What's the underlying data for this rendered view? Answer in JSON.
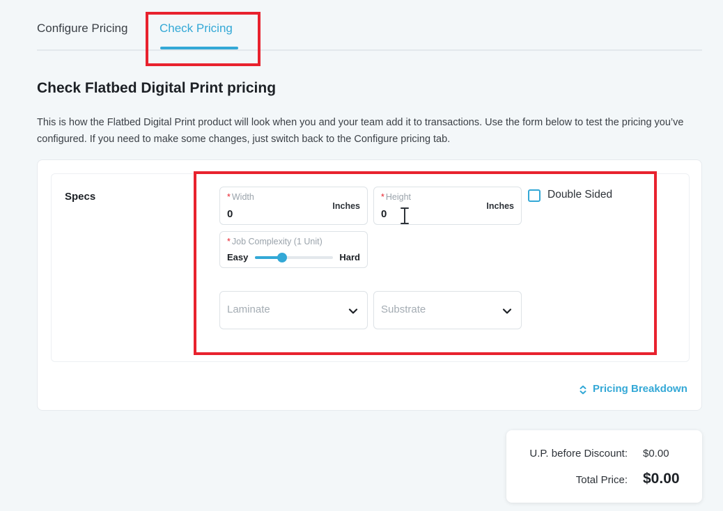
{
  "tabs": [
    {
      "label": "Configure Pricing",
      "active": false
    },
    {
      "label": "Check Pricing",
      "active": true
    }
  ],
  "heading": "Check Flatbed Digital Print pricing",
  "description": "This is how the Flatbed Digital Print product will look when you and your team add it to transactions. Use the form below to test the pricing you’ve configured. If you need to make some changes, just switch back to the Configure pricing tab.",
  "specs": {
    "label": "Specs",
    "width": {
      "label": "Width",
      "value": "0",
      "unit": "Inches"
    },
    "height": {
      "label": "Height",
      "value": "0",
      "unit": "Inches"
    },
    "double_sided": {
      "label": "Double Sided",
      "checked": false
    },
    "job_complexity": {
      "label": "Job Complexity (1 Unit)",
      "min_label": "Easy",
      "max_label": "Hard",
      "level": 0.35
    },
    "laminate": {
      "placeholder": "Laminate"
    },
    "substrate": {
      "placeholder": "Substrate"
    }
  },
  "pricing_breakdown_label": "Pricing Breakdown",
  "totals": {
    "up_before_discount_label": "U.P. before Discount:",
    "up_before_discount_value": "$0.00",
    "total_price_label": "Total Price:",
    "total_price_value": "$0.00"
  },
  "colors": {
    "accent": "#33a8d6",
    "highlight": "#e8222e",
    "required": "#e8222e"
  }
}
